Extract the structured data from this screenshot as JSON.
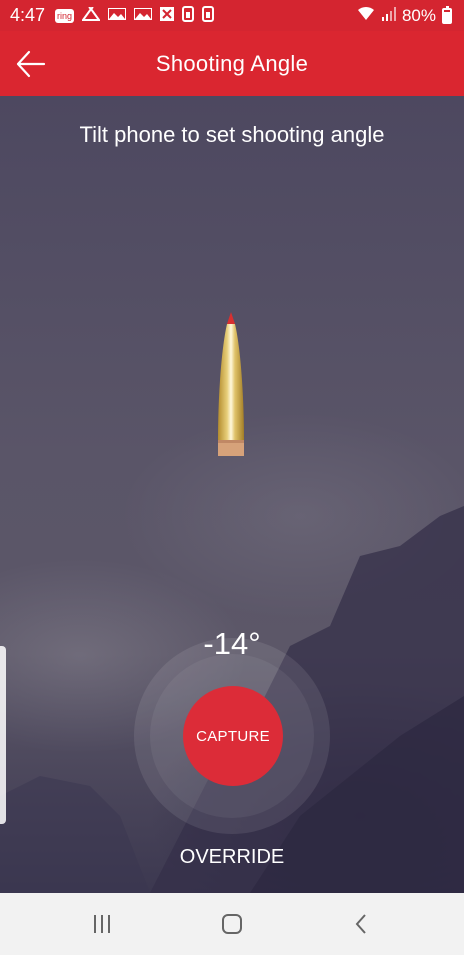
{
  "status_bar": {
    "time": "4:47",
    "ring_badge": "ring",
    "battery_percent": "80%",
    "background": "#d42530"
  },
  "app_bar": {
    "title": "Shooting Angle",
    "background": "#da2630"
  },
  "main": {
    "instruction": "Tilt phone to set shooting angle",
    "angle_value": "-14°",
    "capture_label": "CAPTURE",
    "override_label": "OVERRIDE",
    "accent_color": "#dc2c38"
  },
  "icons": {
    "back": "arrow-left-icon",
    "projectile": "bullet-icon",
    "nav_recents": "recents-icon",
    "nav_home": "home-icon",
    "nav_back": "back-chevron-icon"
  }
}
